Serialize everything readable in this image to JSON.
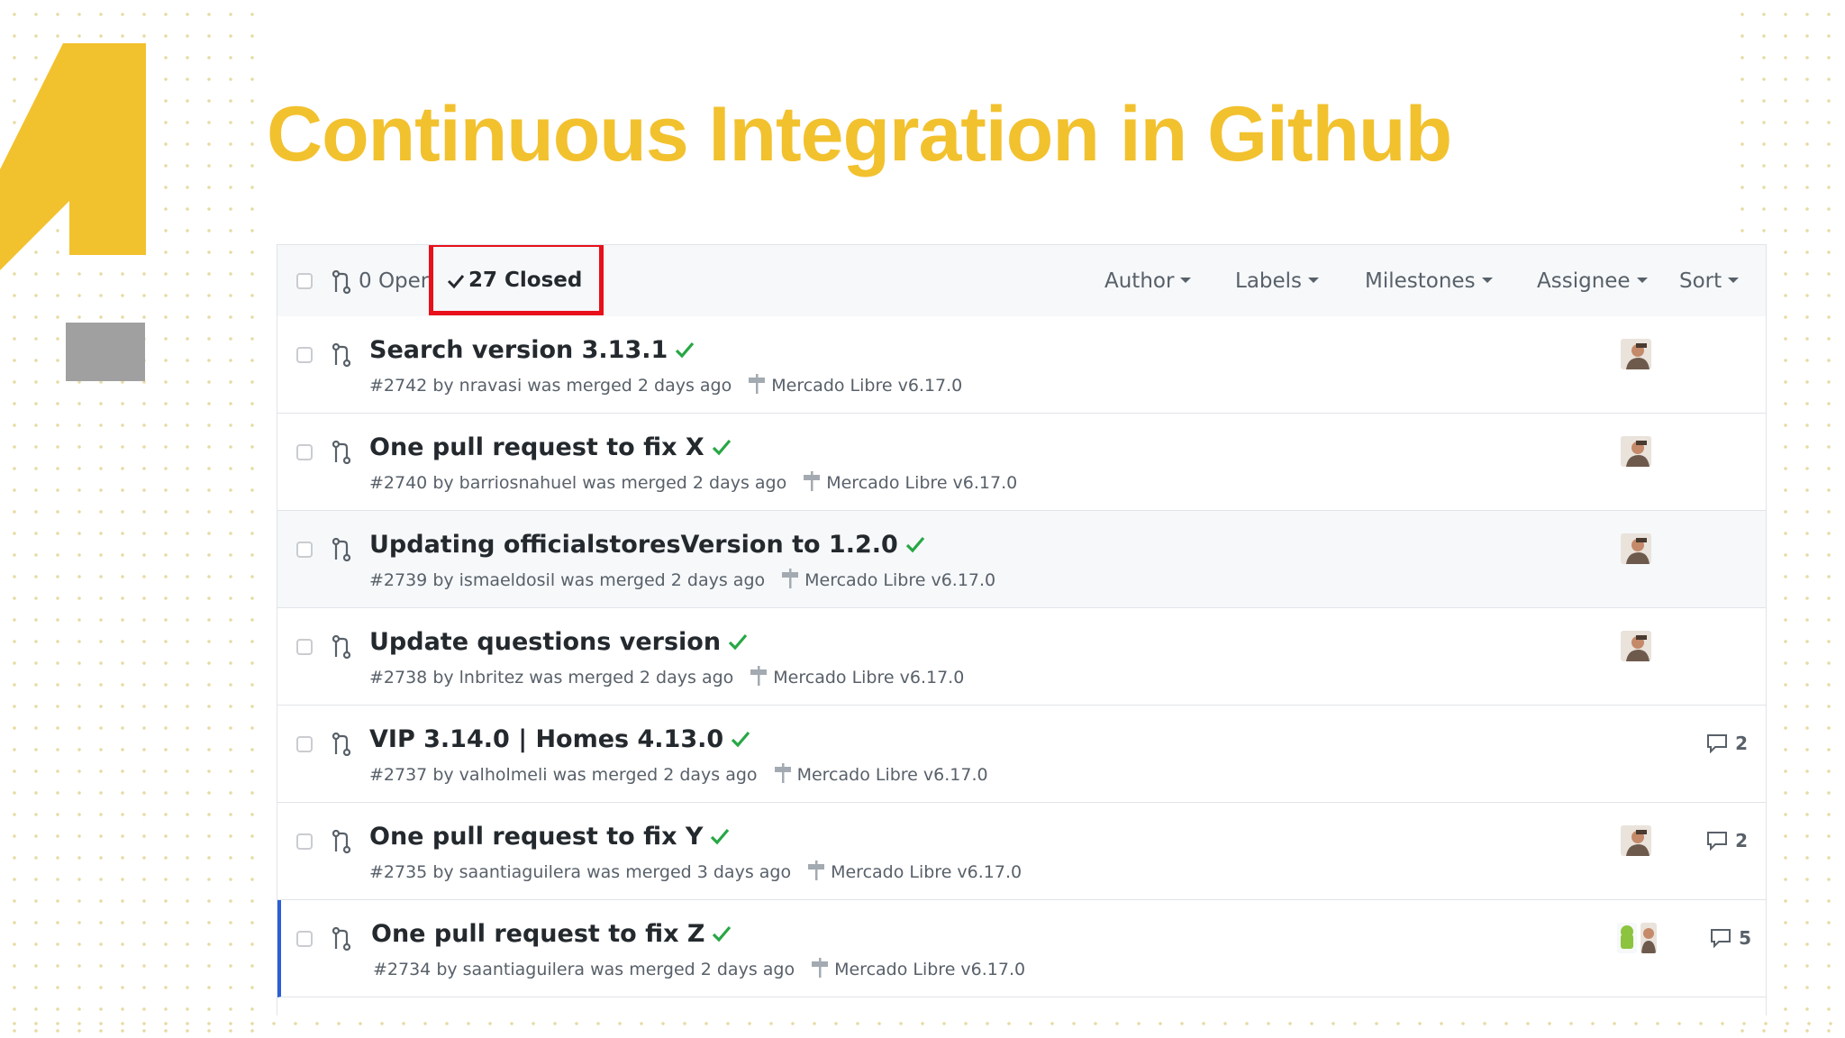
{
  "slide": {
    "title": "Continuous Integration in Github",
    "accent_color": "#f2c12e"
  },
  "filters": {
    "open_label": "0 Open",
    "closed_label": "27 Closed",
    "menus": [
      "Author",
      "Labels",
      "Milestones",
      "Assignee",
      "Sort"
    ]
  },
  "pull_requests": [
    {
      "title": "Search version 3.13.1",
      "meta": "#2742 by nravasi was merged 2 days ago",
      "milestone": "Mercado Libre v6.17.0",
      "status": "success-check-icon",
      "comments": ""
    },
    {
      "title": "One pull request to fix X",
      "meta": "#2740 by barriosnahuel was merged 2 days ago",
      "milestone": "Mercado Libre v6.17.0",
      "status": "success-check-icon",
      "comments": ""
    },
    {
      "title": "Updating officialstoresVersion to 1.2.0",
      "meta": "#2739 by ismaeldosil was merged 2 days ago",
      "milestone": "Mercado Libre v6.17.0",
      "status": "success-check-icon",
      "comments": ""
    },
    {
      "title": "Update questions version",
      "meta": "#2738 by lnbritez was merged 2 days ago",
      "milestone": "Mercado Libre v6.17.0",
      "status": "success-check-icon",
      "comments": ""
    },
    {
      "title": "VIP 3.14.0 | Homes 4.13.0",
      "meta": "#2737 by valholmeli was merged 2 days ago",
      "milestone": "Mercado Libre v6.17.0",
      "status": "success-check-icon",
      "comments": "2"
    },
    {
      "title": "One pull request to fix Y",
      "meta": "#2735 by saantiaguilera was merged 3 days ago",
      "milestone": "Mercado Libre v6.17.0",
      "status": "success-check-icon",
      "comments": "2"
    },
    {
      "title": "One pull request to fix Z",
      "meta": "#2734 by saantiaguilera was merged 2 days ago",
      "milestone": "Mercado Libre v6.17.0",
      "status": "success-check-icon",
      "comments": "5"
    }
  ],
  "colors": {
    "highlight_box": "#e8101a",
    "success": "#28a745",
    "selected_row_border": "#2c5fd6"
  }
}
